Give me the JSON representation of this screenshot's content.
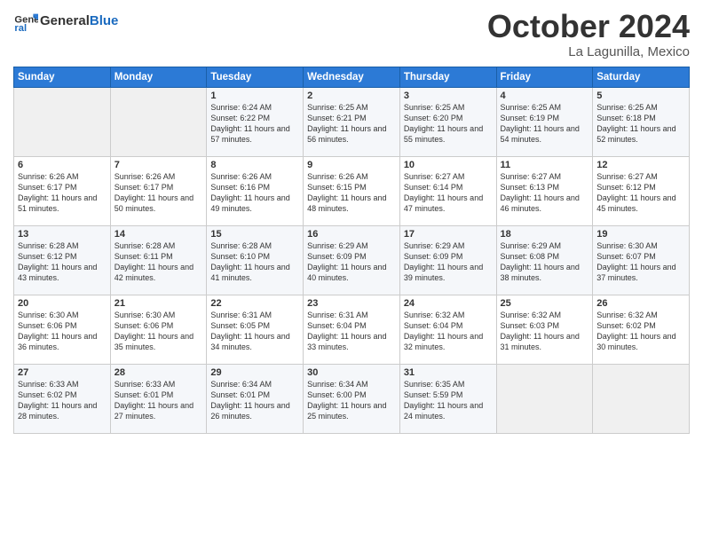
{
  "logo": {
    "line1": "General",
    "line2": "Blue"
  },
  "title": "October 2024",
  "location": "La Lagunilla, Mexico",
  "days_of_week": [
    "Sunday",
    "Monday",
    "Tuesday",
    "Wednesday",
    "Thursday",
    "Friday",
    "Saturday"
  ],
  "weeks": [
    [
      {
        "day": "",
        "info": ""
      },
      {
        "day": "",
        "info": ""
      },
      {
        "day": "1",
        "info": "Sunrise: 6:24 AM\nSunset: 6:22 PM\nDaylight: 11 hours and 57 minutes."
      },
      {
        "day": "2",
        "info": "Sunrise: 6:25 AM\nSunset: 6:21 PM\nDaylight: 11 hours and 56 minutes."
      },
      {
        "day": "3",
        "info": "Sunrise: 6:25 AM\nSunset: 6:20 PM\nDaylight: 11 hours and 55 minutes."
      },
      {
        "day": "4",
        "info": "Sunrise: 6:25 AM\nSunset: 6:19 PM\nDaylight: 11 hours and 54 minutes."
      },
      {
        "day": "5",
        "info": "Sunrise: 6:25 AM\nSunset: 6:18 PM\nDaylight: 11 hours and 52 minutes."
      }
    ],
    [
      {
        "day": "6",
        "info": "Sunrise: 6:26 AM\nSunset: 6:17 PM\nDaylight: 11 hours and 51 minutes."
      },
      {
        "day": "7",
        "info": "Sunrise: 6:26 AM\nSunset: 6:17 PM\nDaylight: 11 hours and 50 minutes."
      },
      {
        "day": "8",
        "info": "Sunrise: 6:26 AM\nSunset: 6:16 PM\nDaylight: 11 hours and 49 minutes."
      },
      {
        "day": "9",
        "info": "Sunrise: 6:26 AM\nSunset: 6:15 PM\nDaylight: 11 hours and 48 minutes."
      },
      {
        "day": "10",
        "info": "Sunrise: 6:27 AM\nSunset: 6:14 PM\nDaylight: 11 hours and 47 minutes."
      },
      {
        "day": "11",
        "info": "Sunrise: 6:27 AM\nSunset: 6:13 PM\nDaylight: 11 hours and 46 minutes."
      },
      {
        "day": "12",
        "info": "Sunrise: 6:27 AM\nSunset: 6:12 PM\nDaylight: 11 hours and 45 minutes."
      }
    ],
    [
      {
        "day": "13",
        "info": "Sunrise: 6:28 AM\nSunset: 6:12 PM\nDaylight: 11 hours and 43 minutes."
      },
      {
        "day": "14",
        "info": "Sunrise: 6:28 AM\nSunset: 6:11 PM\nDaylight: 11 hours and 42 minutes."
      },
      {
        "day": "15",
        "info": "Sunrise: 6:28 AM\nSunset: 6:10 PM\nDaylight: 11 hours and 41 minutes."
      },
      {
        "day": "16",
        "info": "Sunrise: 6:29 AM\nSunset: 6:09 PM\nDaylight: 11 hours and 40 minutes."
      },
      {
        "day": "17",
        "info": "Sunrise: 6:29 AM\nSunset: 6:09 PM\nDaylight: 11 hours and 39 minutes."
      },
      {
        "day": "18",
        "info": "Sunrise: 6:29 AM\nSunset: 6:08 PM\nDaylight: 11 hours and 38 minutes."
      },
      {
        "day": "19",
        "info": "Sunrise: 6:30 AM\nSunset: 6:07 PM\nDaylight: 11 hours and 37 minutes."
      }
    ],
    [
      {
        "day": "20",
        "info": "Sunrise: 6:30 AM\nSunset: 6:06 PM\nDaylight: 11 hours and 36 minutes."
      },
      {
        "day": "21",
        "info": "Sunrise: 6:30 AM\nSunset: 6:06 PM\nDaylight: 11 hours and 35 minutes."
      },
      {
        "day": "22",
        "info": "Sunrise: 6:31 AM\nSunset: 6:05 PM\nDaylight: 11 hours and 34 minutes."
      },
      {
        "day": "23",
        "info": "Sunrise: 6:31 AM\nSunset: 6:04 PM\nDaylight: 11 hours and 33 minutes."
      },
      {
        "day": "24",
        "info": "Sunrise: 6:32 AM\nSunset: 6:04 PM\nDaylight: 11 hours and 32 minutes."
      },
      {
        "day": "25",
        "info": "Sunrise: 6:32 AM\nSunset: 6:03 PM\nDaylight: 11 hours and 31 minutes."
      },
      {
        "day": "26",
        "info": "Sunrise: 6:32 AM\nSunset: 6:02 PM\nDaylight: 11 hours and 30 minutes."
      }
    ],
    [
      {
        "day": "27",
        "info": "Sunrise: 6:33 AM\nSunset: 6:02 PM\nDaylight: 11 hours and 28 minutes."
      },
      {
        "day": "28",
        "info": "Sunrise: 6:33 AM\nSunset: 6:01 PM\nDaylight: 11 hours and 27 minutes."
      },
      {
        "day": "29",
        "info": "Sunrise: 6:34 AM\nSunset: 6:01 PM\nDaylight: 11 hours and 26 minutes."
      },
      {
        "day": "30",
        "info": "Sunrise: 6:34 AM\nSunset: 6:00 PM\nDaylight: 11 hours and 25 minutes."
      },
      {
        "day": "31",
        "info": "Sunrise: 6:35 AM\nSunset: 5:59 PM\nDaylight: 11 hours and 24 minutes."
      },
      {
        "day": "",
        "info": ""
      },
      {
        "day": "",
        "info": ""
      }
    ]
  ]
}
